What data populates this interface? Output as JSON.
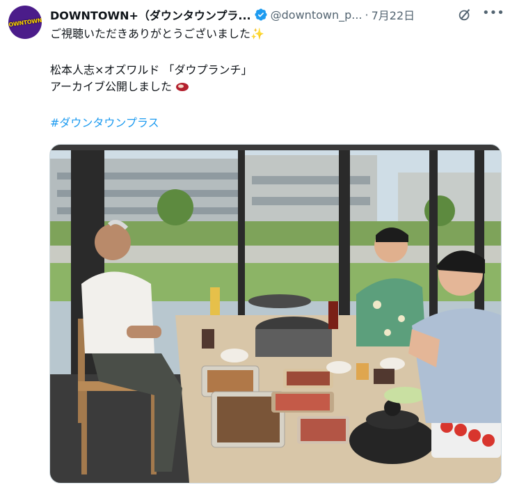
{
  "author": {
    "avatar_text": "DOWNTOWN+",
    "display_name": "DOWNTOWN+（ダウンタウンプラ...",
    "handle": "@downtown_p...",
    "date": "7月22日",
    "verified": true
  },
  "icons": {
    "verified": "verified-badge-icon",
    "grok": "grok-icon",
    "more": "more-icon"
  },
  "tweet": {
    "line1": "ご視聴いただきありがとうございました",
    "line1_emoji": "✨",
    "line2": "松本人志×オズワルド 「ダウプランチ」",
    "line3": "アーカイブ公開しました",
    "hashtag": "#ダウンタウンプラス"
  },
  "colors": {
    "link": "#1d9bf0",
    "text": "#0f1419",
    "secondary": "#536471",
    "avatar_bg": "#4b1c8a"
  }
}
